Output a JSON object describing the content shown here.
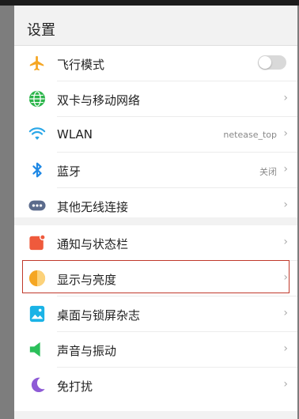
{
  "header": {
    "title": "设置"
  },
  "groups": [
    {
      "items": [
        {
          "label": "飞行模式",
          "icon": "airplane-icon",
          "color": "#f5a623",
          "control": "toggle",
          "toggle_on": false
        },
        {
          "label": "双卡与移动网络",
          "icon": "globe-icon",
          "color": "#2bb54a",
          "control": "chevron"
        },
        {
          "label": "WLAN",
          "icon": "wifi-icon",
          "color": "#2aa7e8",
          "value": "netease_top",
          "control": "chevron"
        },
        {
          "label": "蓝牙",
          "icon": "bluetooth-icon",
          "color": "#1e88e5",
          "value": "关闭",
          "control": "chevron"
        },
        {
          "label": "其他无线连接",
          "icon": "more-connections-icon",
          "color": "#5b6b8c",
          "control": "chevron"
        }
      ]
    },
    {
      "items": [
        {
          "label": "通知与状态栏",
          "icon": "notification-icon",
          "color": "#ef5a3c",
          "control": "chevron"
        },
        {
          "label": "显示与亮度",
          "icon": "brightness-icon",
          "color": "#f5a623",
          "control": "chevron",
          "highlighted": true
        },
        {
          "label": "桌面与锁屏杂志",
          "icon": "wallpaper-icon",
          "color": "#1ab3e6",
          "control": "chevron"
        },
        {
          "label": "声音与振动",
          "icon": "sound-icon",
          "color": "#2bbf5a",
          "control": "chevron"
        },
        {
          "label": "免打扰",
          "icon": "moon-icon",
          "color": "#8e5bd6",
          "control": "chevron"
        }
      ]
    }
  ],
  "chevron": "›",
  "highlight_color": "#c0392b"
}
